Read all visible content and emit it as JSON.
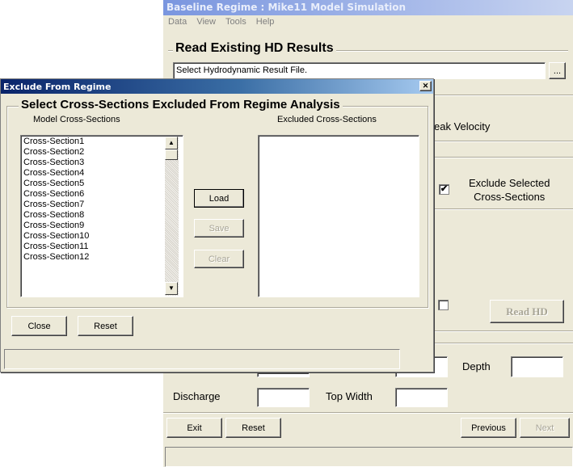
{
  "background_window": {
    "title": "Baseline Regime  :  Mike11 Model Simulation",
    "menu": [
      "Data",
      "View",
      "Tools",
      "Help"
    ],
    "read_group_title": "Read Existing HD Results",
    "hd_file_field": "Select Hydrodynamic Result File.",
    "browse_label": "...",
    "peak_velocity_label": "eak Velocity",
    "exclude_selected_label_line1": "Exclude Selected",
    "exclude_selected_label_line2": "Cross-Sections",
    "exclude_selected_check": "✔",
    "read_hd_label": "Read HD",
    "depth_label": "Depth",
    "discharge_label": "Discharge",
    "top_width_label": "Top Width",
    "exit_label": "Exit",
    "reset_label": "Reset",
    "previous_label": "Previous",
    "next_label": "Next"
  },
  "dialog": {
    "title": "Exclude From Regime",
    "close_glyph": "✕",
    "group_title": "Select Cross-Sections Excluded From Regime Analysis",
    "model_header": "Model Cross-Sections",
    "excluded_header": "Excluded Cross-Sections",
    "model_items": [
      "Cross-Section1",
      "Cross-Section2",
      "Cross-Section3",
      "Cross-Section4",
      "Cross-Section5",
      "Cross-Section6",
      "Cross-Section7",
      "Cross-Section8",
      "Cross-Section9",
      "Cross-Section10",
      "Cross-Section11",
      "Cross-Section12"
    ],
    "excluded_items": [],
    "load_label": "Load",
    "save_label": "Save",
    "clear_label": "Clear",
    "close_label": "Close",
    "reset_label": "Reset",
    "scroll_up_glyph": "▲",
    "scroll_down_glyph": "▼"
  }
}
